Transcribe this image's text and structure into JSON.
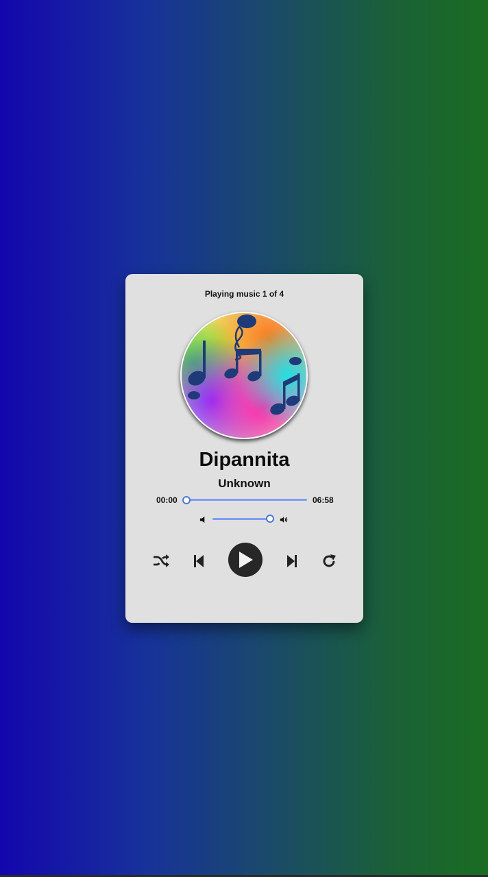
{
  "player": {
    "track_counter": "Playing music 1 of 4",
    "title": "Dipannita",
    "artist": "Unknown",
    "current_time": "00:00",
    "total_time": "06:58",
    "progress": 0.0,
    "volume": 1.0
  },
  "icons": {
    "volume_down": "volume-down-icon",
    "volume_up": "volume-up-icon",
    "shuffle": "shuffle-icon",
    "previous": "skip-previous-icon",
    "play": "play-icon",
    "next": "skip-next-icon",
    "repeat": "repeat-icon",
    "album_art": "music-notes-artwork"
  },
  "colors": {
    "background_left": "#1406ad",
    "background_right": "#1a6d22",
    "card": "#e0e0e0",
    "slider": "#7d9ef2",
    "play_button": "#272727"
  }
}
